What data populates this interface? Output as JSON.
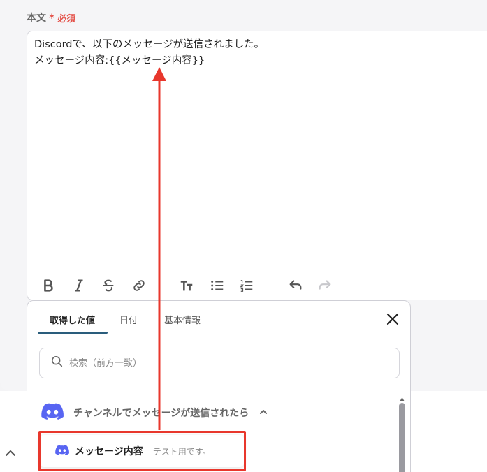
{
  "field": {
    "label": "本文",
    "required_mark": "*",
    "required_text": "必須"
  },
  "editor": {
    "lines": [
      "Discordで、以下のメッセージが送信されました。",
      "メッセージ内容:{{メッセージ内容}}"
    ]
  },
  "toolbar": {
    "buttons": [
      "bold-icon",
      "italic-icon",
      "strikethrough-icon",
      "link-icon",
      "text-size-icon",
      "bullet-list-icon",
      "numbered-list-icon",
      "undo-icon",
      "redo-icon"
    ]
  },
  "popup": {
    "tabs": [
      {
        "label": "取得した値",
        "active": true
      },
      {
        "label": "日付",
        "active": false
      },
      {
        "label": "基本情報",
        "active": false
      }
    ],
    "search": {
      "placeholder": "検索（前方一致）"
    },
    "group": {
      "label": "チャンネルでメッセージが送信されたら",
      "expanded": true
    },
    "item": {
      "label": "メッセージ内容",
      "value": "テスト用です。"
    }
  },
  "colors": {
    "accent": "#2a5d7c",
    "required": "#e4524a",
    "annotation": "#e8372c",
    "discord": "#5865f2"
  }
}
